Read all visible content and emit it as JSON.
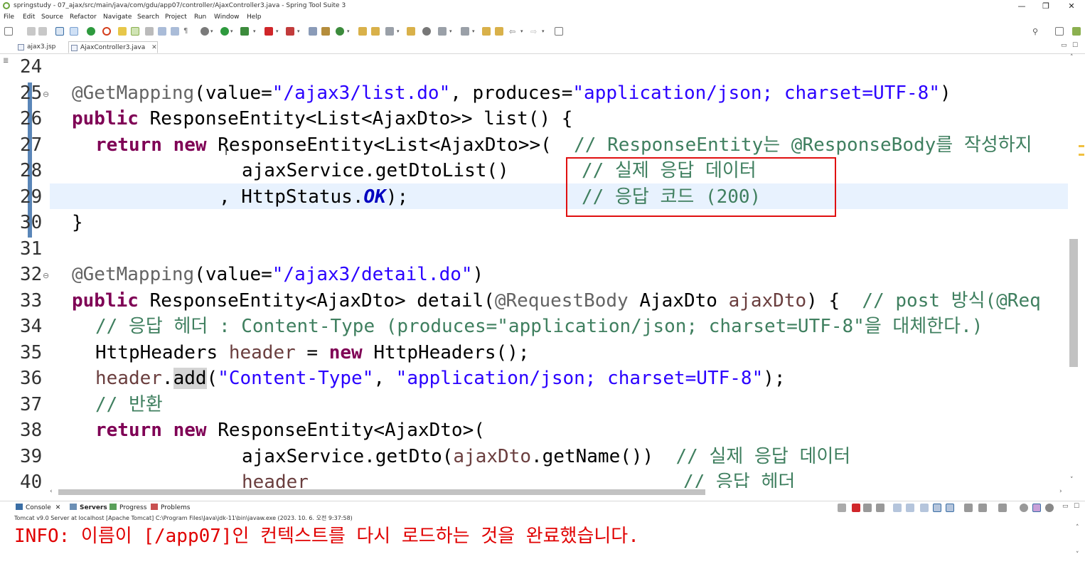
{
  "window": {
    "title": "springstudy - 07_ajax/src/main/java/com/gdu/app07/controller/AjaxController3.java - Spring Tool Suite 3",
    "minimize": "—",
    "maximize": "❐",
    "close": "✕"
  },
  "menu": [
    "File",
    "Edit",
    "Source",
    "Refactor",
    "Navigate",
    "Search",
    "Project",
    "Run",
    "Window",
    "Help"
  ],
  "tabs": [
    {
      "label": "ajax3.jsp",
      "active": false
    },
    {
      "label": "AjaxController3.java",
      "active": true,
      "close": "✕"
    }
  ],
  "editor": {
    "line_numbers": [
      "24",
      "25",
      "26",
      "27",
      "28",
      "29",
      "30",
      "31",
      "32",
      "33",
      "34",
      "35",
      "36",
      "37",
      "38",
      "39",
      "40"
    ],
    "lines": {
      "l25": {
        "a1": "@GetMapping",
        "t1": "(value=",
        "s1": "\"/ajax3/list.do\"",
        "t2": ", produces=",
        "s2": "\"application/json; charset=UTF-8\"",
        "t3": ")"
      },
      "l26": {
        "k1": "public",
        "t1": " ResponseEntity<List<AjaxDto>> list() {"
      },
      "l27": {
        "k1": "return",
        "k2": "new",
        "t1": " ResponseEntity<List<AjaxDto>>(  ",
        "c1": "// ResponseEntity는 @ResponseBody를 작성하지"
      },
      "l28": {
        "t1": "ajaxService.getDtoList()",
        "c1": "// 실제 응답 데이터"
      },
      "l29": {
        "t1": ", HttpStatus.",
        "k1": "OK",
        "t2": ");",
        "c1": "// 응답 코드 (200)"
      },
      "l30": {
        "t1": "}"
      },
      "l32": {
        "a1": "@GetMapping",
        "t1": "(value=",
        "s1": "\"/ajax3/detail.do\"",
        "t2": ")"
      },
      "l33": {
        "k1": "public",
        "t1": " ResponseEntity<AjaxDto> detail(",
        "a1": "@RequestBody",
        "t2": " AjaxDto ",
        "v1": "ajaxDto",
        "t3": ") {  ",
        "c1": "// post 방식(@Req"
      },
      "l34": {
        "c1": "// 응답 헤더 : Content-Type (produces=\"application/json; charset=UTF-8\"을 대체한다.)"
      },
      "l35": {
        "t1": "HttpHeaders ",
        "v1": "header",
        "t2": " = ",
        "k1": "new",
        "t3": " HttpHeaders();"
      },
      "l36": {
        "v1": "header",
        "t1": ".",
        "h1": "add",
        "t2": "(",
        "s1": "\"Content-Type\"",
        "t3": ", ",
        "s2": "\"application/json; charset=UTF-8\"",
        "t4": ");"
      },
      "l37": {
        "c1": "// 반환"
      },
      "l38": {
        "k1": "return",
        "k2": "new",
        "t1": " ResponseEntity<AjaxDto>("
      },
      "l39": {
        "t1": "ajaxService.getDto(",
        "v1": "ajaxDto",
        "t2": ".getName())  ",
        "c1": "// 실제 응답 데이터"
      },
      "l40": {
        "v1": "header",
        "c1": "// 응답 헤더"
      }
    }
  },
  "console": {
    "tabs": [
      "Console",
      "Servers",
      "Progress",
      "Problems"
    ],
    "status": "Tomcat v9.0 Server at localhost [Apache Tomcat] C:\\Program Files\\Java\\jdk-11\\bin\\javaw.exe  (2023. 10. 6. 오전 9:37:58)",
    "output": "INFO: 이름이 [/app07]인 컨텍스트를 다시 로드하는 것을 완료했습니다."
  },
  "colors": {
    "keyword": "#7f0055",
    "string": "#2a00ff",
    "comment": "#3f7f5f",
    "annotation_box": "#e01010",
    "console_text": "#e00000"
  }
}
